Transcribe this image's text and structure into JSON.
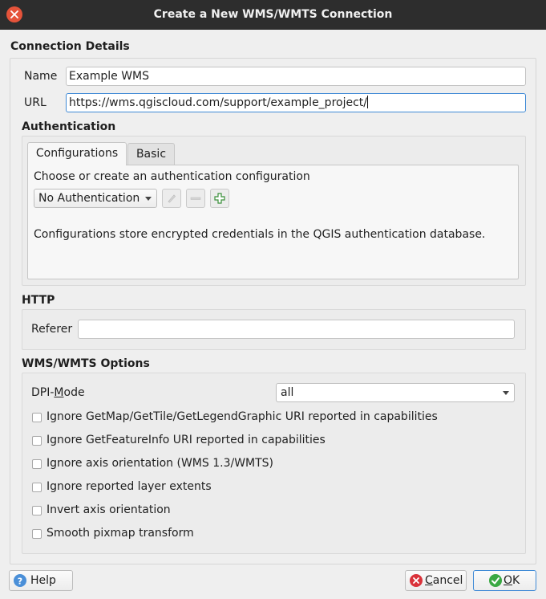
{
  "window": {
    "title": "Create a New WMS/WMTS Connection",
    "close_icon": "close-icon"
  },
  "connection": {
    "title": "Connection Details",
    "name_label": "Name",
    "name_value": "Example WMS",
    "url_label": "URL",
    "url_value": "https://wms.qgiscloud.com/support/example_project/"
  },
  "authentication": {
    "title": "Authentication",
    "tabs": [
      "Configurations",
      "Basic"
    ],
    "active_tab": "Configurations",
    "prompt": "Choose or create an authentication configuration",
    "selected": "No Authentication",
    "info": "Configurations store encrypted credentials in the QGIS authentication database.",
    "buttons": [
      "edit-icon",
      "remove-icon",
      "add-icon"
    ]
  },
  "http": {
    "title": "HTTP",
    "referer_label": "Referer",
    "referer_value": ""
  },
  "options": {
    "title": "WMS/WMTS Options",
    "dpi_label_pre": "DPI-",
    "dpi_label_mnemonic": "M",
    "dpi_label_post": "ode",
    "dpi_value": "all",
    "checkboxes": [
      {
        "label": "Ignore GetMap/GetTile/GetLegendGraphic URI reported in capabilities",
        "checked": false
      },
      {
        "label": "Ignore GetFeatureInfo URI reported in capabilities",
        "checked": false
      },
      {
        "label": "Ignore axis orientation (WMS 1.3/WMTS)",
        "checked": false
      },
      {
        "label": "Ignore reported layer extents",
        "checked": false
      },
      {
        "label": "Invert axis orientation",
        "checked": false
      },
      {
        "label": "Smooth pixmap transform",
        "checked": false
      }
    ]
  },
  "buttons": {
    "help": "Help",
    "cancel_mnemonic": "C",
    "cancel_rest": "ancel",
    "ok_mnemonic": "O",
    "ok_rest": "K"
  },
  "colors": {
    "titlebar": "#2d2d2d",
    "close": "#e5533a",
    "focus": "#3f8ad6",
    "help_icon": "#4a8fd8",
    "cancel_icon": "#d9323a",
    "ok_icon": "#3aa843"
  }
}
